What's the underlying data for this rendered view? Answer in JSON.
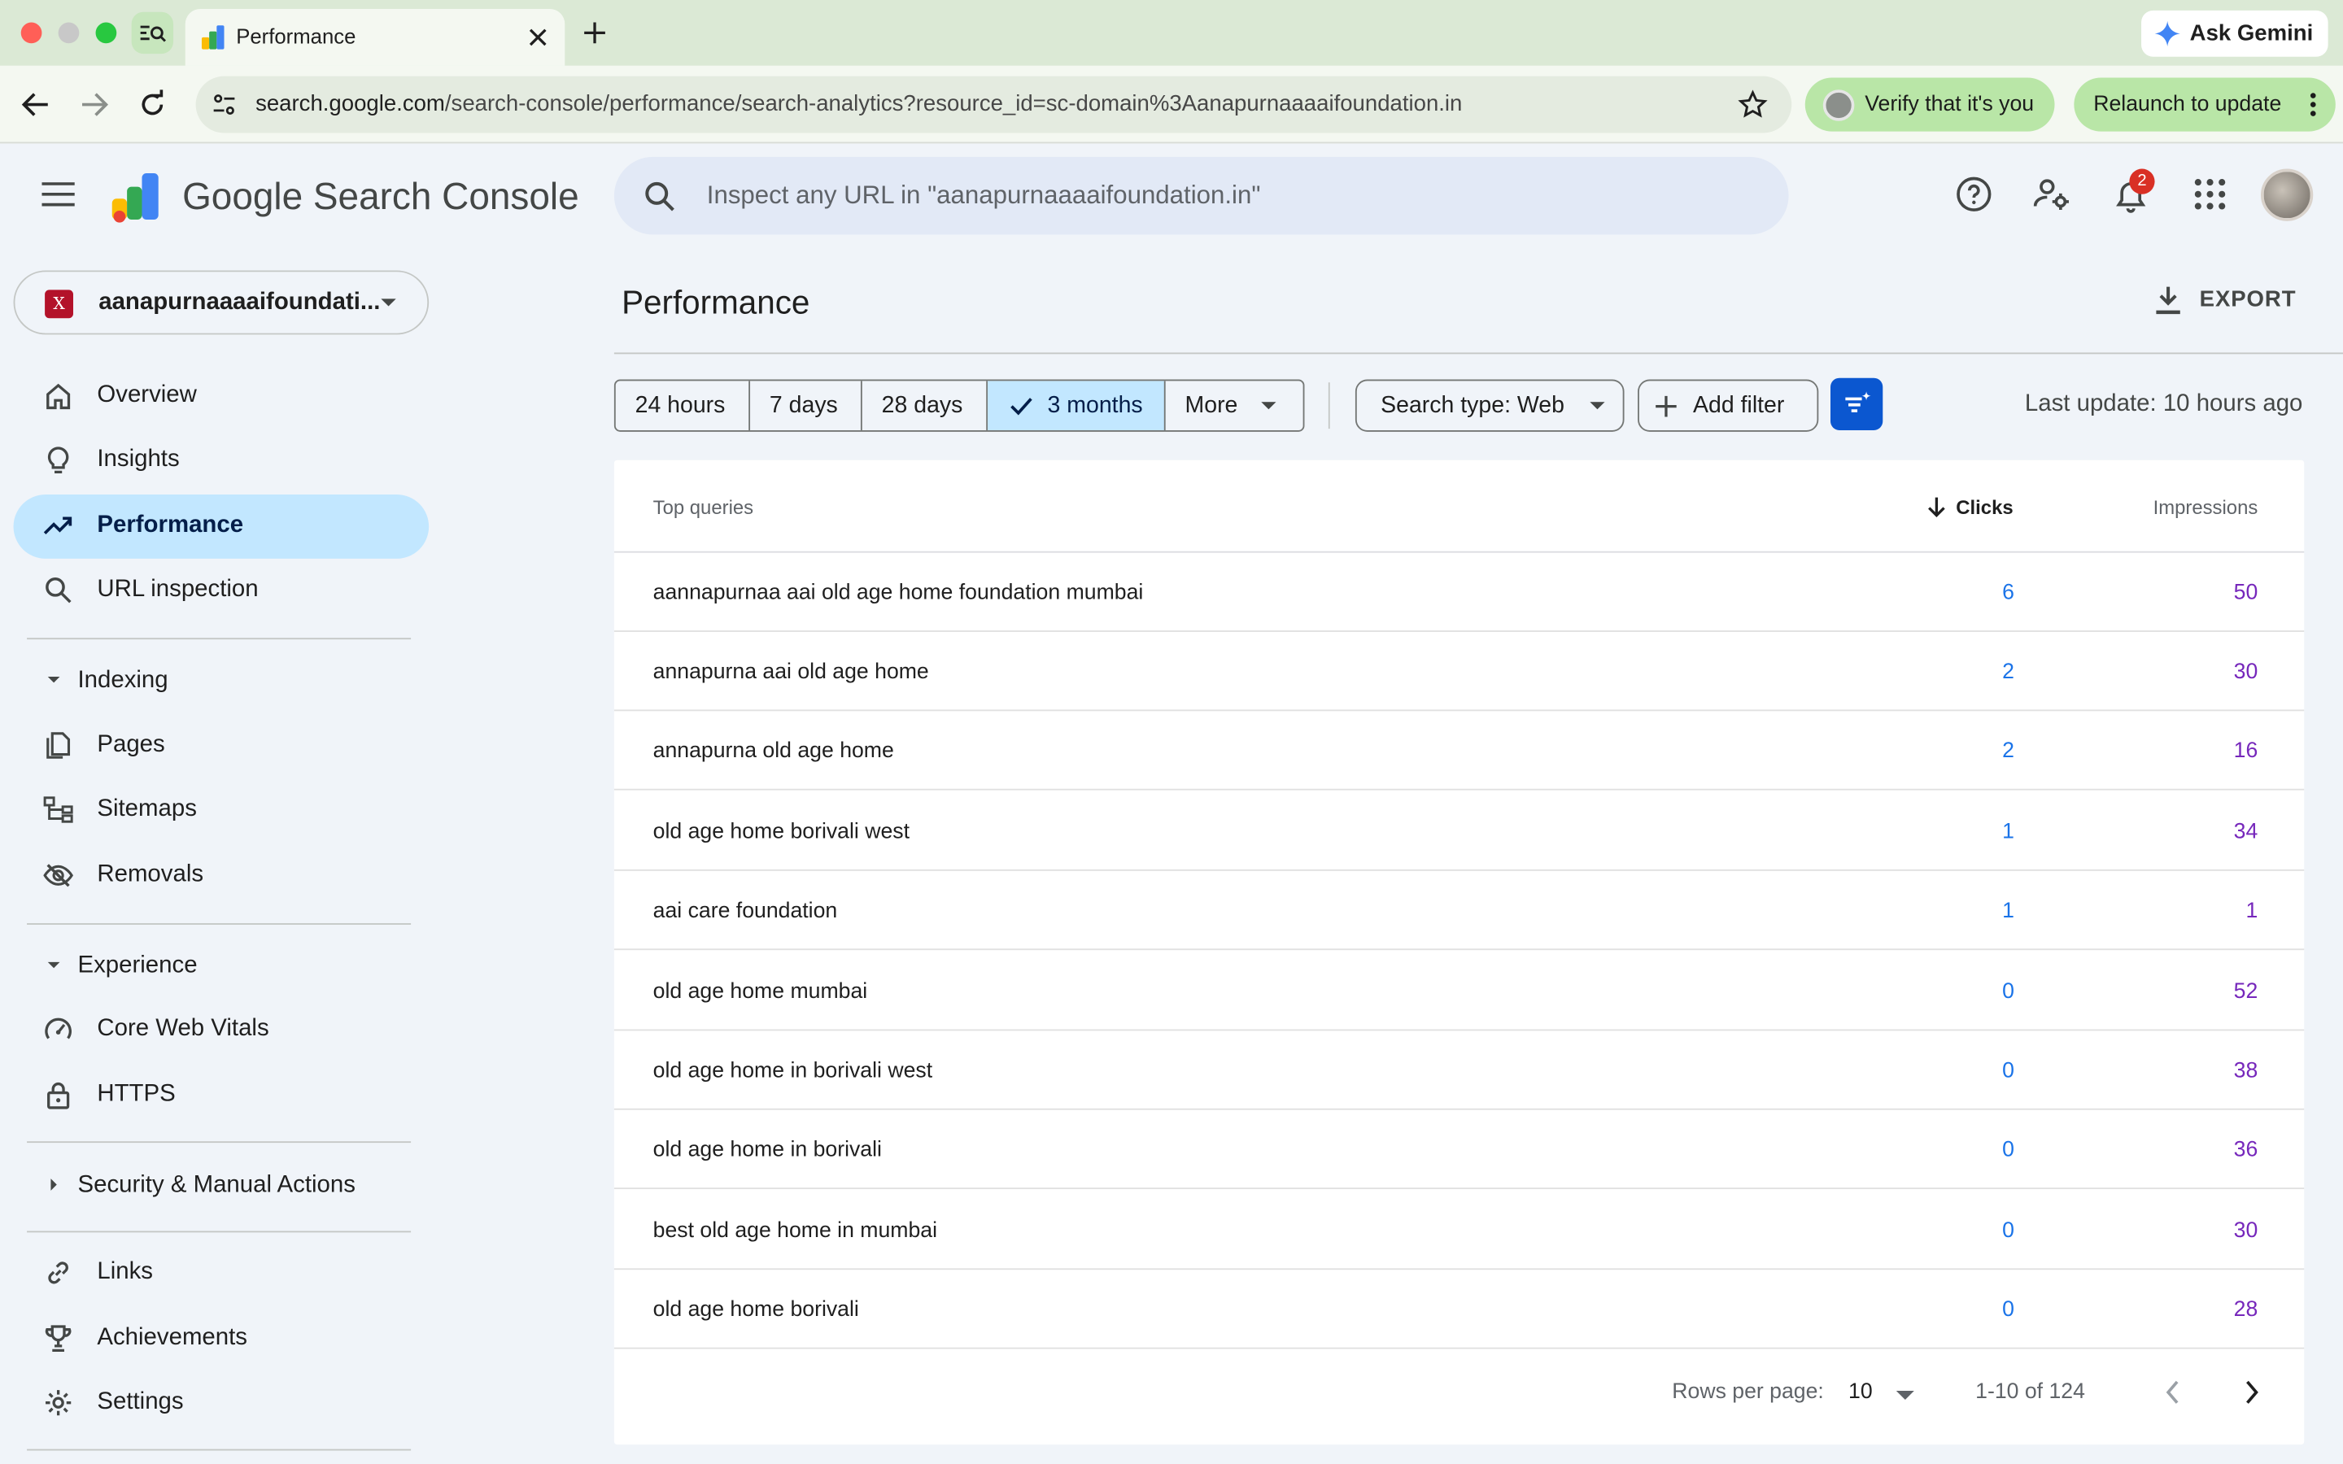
{
  "browser": {
    "tab_title": "Performance",
    "url_host": "search.google.com",
    "url_path": "/search-console/performance/search-analytics?resource_id=sc-domain%3Aanapurnaaaaifoundation.in",
    "ask_gemini": "Ask Gemini",
    "verify": "Verify that it's you",
    "relaunch": "Relaunch to update"
  },
  "header": {
    "product_name": "Google Search Console",
    "search_placeholder": "Inspect any URL in \"aanapurnaaaaifoundation.in\"",
    "notification_count": "2"
  },
  "sidebar": {
    "property": "aanapurnaaaaifoundati...",
    "property_badge": "X",
    "items": [
      {
        "label": "Overview",
        "icon": "home-icon"
      },
      {
        "label": "Insights",
        "icon": "lightbulb-icon"
      },
      {
        "label": "Performance",
        "icon": "trending-up-icon"
      },
      {
        "label": "URL inspection",
        "icon": "search-icon"
      }
    ],
    "indexing": {
      "title": "Indexing",
      "items": [
        {
          "label": "Pages",
          "icon": "pages-icon"
        },
        {
          "label": "Sitemaps",
          "icon": "sitemap-icon"
        },
        {
          "label": "Removals",
          "icon": "eye-off-icon"
        }
      ]
    },
    "experience": {
      "title": "Experience",
      "items": [
        {
          "label": "Core Web Vitals",
          "icon": "gauge-icon"
        },
        {
          "label": "HTTPS",
          "icon": "lock-icon"
        }
      ]
    },
    "security": {
      "title": "Security & Manual Actions"
    },
    "bottom": [
      {
        "label": "Links",
        "icon": "link-icon"
      },
      {
        "label": "Achievements",
        "icon": "trophy-icon"
      },
      {
        "label": "Settings",
        "icon": "gear-icon"
      }
    ]
  },
  "main": {
    "title": "Performance",
    "export": "EXPORT",
    "ranges": [
      "24 hours",
      "7 days",
      "28 days",
      "3 months",
      "More"
    ],
    "selected_range": "3 months",
    "search_type": "Search type: Web",
    "add_filter": "Add filter",
    "last_update": "Last update: 10 hours ago"
  },
  "table": {
    "col_query": "Top queries",
    "col_clicks": "Clicks",
    "col_impressions": "Impressions",
    "rows": [
      {
        "query": "aannapurnaa aai old age home foundation mumbai",
        "clicks": "6",
        "impressions": "50"
      },
      {
        "query": "annapurna aai old age home",
        "clicks": "2",
        "impressions": "30"
      },
      {
        "query": "annapurna old age home",
        "clicks": "2",
        "impressions": "16"
      },
      {
        "query": "old age home borivali west",
        "clicks": "1",
        "impressions": "34"
      },
      {
        "query": "aai care foundation",
        "clicks": "1",
        "impressions": "1"
      },
      {
        "query": "old age home mumbai",
        "clicks": "0",
        "impressions": "52"
      },
      {
        "query": "old age home in borivali west",
        "clicks": "0",
        "impressions": "38"
      },
      {
        "query": "old age home in borivali",
        "clicks": "0",
        "impressions": "36"
      },
      {
        "query": "best old age home in mumbai",
        "clicks": "0",
        "impressions": "30"
      },
      {
        "query": "old age home borivali",
        "clicks": "0",
        "impressions": "28"
      }
    ],
    "rows_per_page_label": "Rows per page:",
    "rows_per_page": "10",
    "page_range": "1-10 of 124"
  },
  "colors": {
    "accent": "#0b57d0",
    "active_nav": "#c2e7ff",
    "clicks": "#1a73e8",
    "impressions": "#7627bb"
  }
}
